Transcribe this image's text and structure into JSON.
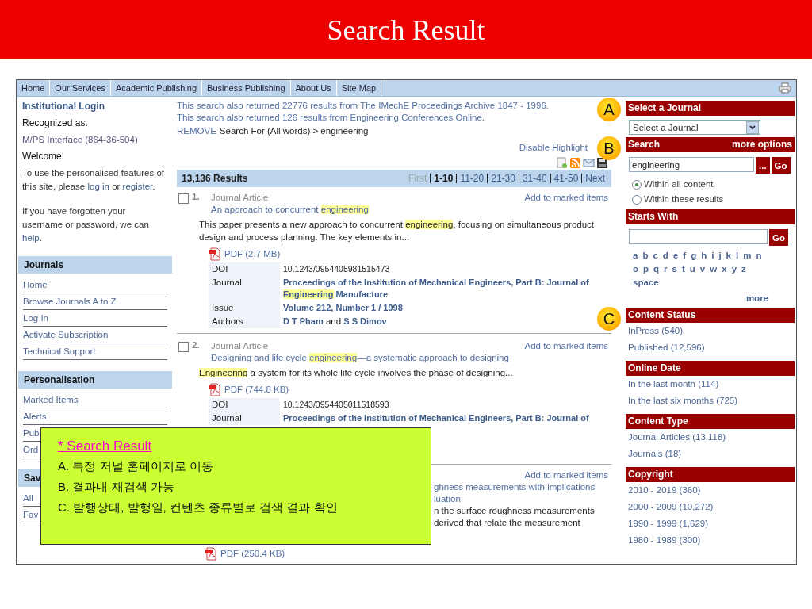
{
  "slide_title": "Search Result",
  "nav": {
    "items": [
      "Home",
      "Our Services",
      "Academic Publishing",
      "Business Publishing",
      "About Us",
      "Site Map"
    ]
  },
  "callouts": [
    "A",
    "B",
    "C"
  ],
  "left": {
    "login_title": "Institutional Login",
    "recognized_label": "Recognized as:",
    "recognized_value": "M/PS Interface (864-36-504)",
    "welcome": "Welcome!",
    "paragraphs": [
      [
        {
          "text": "To use the personalised features of this site, please ",
          "link": false
        },
        {
          "text": "log in",
          "link": true
        },
        {
          "text": " or ",
          "link": false
        },
        {
          "text": "register",
          "link": true
        },
        {
          "text": ".",
          "link": false
        }
      ],
      [
        {
          "text": "If you have forgotten your username or password, we can ",
          "link": false
        },
        {
          "text": "help",
          "link": true
        },
        {
          "text": ".",
          "link": false
        }
      ]
    ],
    "sections": [
      {
        "title": "Journals",
        "items": [
          "Home",
          "Browse Journals A to Z",
          "Log In",
          "Activate Subscription",
          "Technical Support"
        ]
      },
      {
        "title": "Personalisation",
        "items": [
          "Marked Items",
          "Alerts",
          "Pub",
          "Ord"
        ]
      },
      {
        "title": "Sav",
        "items": [
          "All",
          "Fav"
        ]
      }
    ]
  },
  "main": {
    "notices": [
      "This search also returned 22776 results from The IMechE Proceedings Archive 1847 - 1996.",
      "This search also returned 126 results from Engineering Conferences Online."
    ],
    "remove_link": "REMOVE",
    "search_for": "Search For (All words) > engineering",
    "disable_highlight": "Disable Highlight",
    "results_bar": {
      "count": "13,136 Results",
      "pages": [
        {
          "label": "First",
          "selected": false,
          "disabled": true
        },
        {
          "label": "1-10",
          "selected": true,
          "disabled": false
        },
        {
          "label": "11-20",
          "selected": false,
          "disabled": false
        },
        {
          "label": "21-30",
          "selected": false,
          "disabled": false
        },
        {
          "label": "31-40",
          "selected": false,
          "disabled": false
        },
        {
          "label": "41-50",
          "selected": false,
          "disabled": false
        },
        {
          "label": "Next",
          "selected": false,
          "disabled": false
        }
      ]
    },
    "results": [
      {
        "kind": "full",
        "number": "1.",
        "checked": false,
        "type": "Journal Article",
        "add": "Add to marked items",
        "title": [
          {
            "text": "An approach to concurrent ",
            "highlight": false
          },
          {
            "text": "engineering",
            "highlight": true
          }
        ],
        "snippet": [
          {
            "text": "This paper presents a new approach to concurrent ",
            "highlight": false
          },
          {
            "text": "engineering",
            "highlight": true
          },
          {
            "text": ", focusing on simultaneous product design and process planning. The key elements in...",
            "highlight": false
          }
        ],
        "pdf": "PDF (2.7 MB)",
        "meta": [
          {
            "label": "DOI",
            "kind": "plain",
            "value": [
              {
                "text": "10.1243/0954405981515473"
              }
            ]
          },
          {
            "label": "Journal",
            "kind": "link",
            "value": [
              {
                "text": "Proceedings of the Institution of Mechanical Engineers, Part B: Journal of ",
                "highlight": false
              },
              {
                "text": "Engineering",
                "highlight": true
              },
              {
                "text": " Manufacture",
                "highlight": false
              }
            ]
          },
          {
            "label": "Issue",
            "kind": "link",
            "value": [
              {
                "text": "Volume 212, Number 1 / 1998",
                "highlight": false
              }
            ]
          },
          {
            "label": "Authors",
            "kind": "authors",
            "value": [
              {
                "text": "D T Pham",
                "link": true
              },
              {
                "text": " and ",
                "link": false
              },
              {
                "text": "S S Dimov",
                "link": true
              }
            ]
          }
        ]
      },
      {
        "kind": "full",
        "number": "2.",
        "checked": false,
        "type": "Journal Article",
        "add": "Add to marked items",
        "title": [
          {
            "text": "Designing and life cycle ",
            "highlight": false
          },
          {
            "text": "engineering",
            "highlight": true
          },
          {
            "text": "—a systematic approach to designing",
            "highlight": false
          }
        ],
        "snippet": [
          {
            "text": "Engineering",
            "highlight": true
          },
          {
            "text": " a system for its whole life cycle involves the phase of designing...",
            "highlight": false
          }
        ],
        "pdf": "PDF (744.8 KB)",
        "meta": [
          {
            "label": "DOI",
            "kind": "plain",
            "value": [
              {
                "text": "10.1243/0954405011518593"
              }
            ]
          },
          {
            "label": "Journal",
            "kind": "link",
            "value": [
              {
                "text": "Proceedings of the Institution of Mechanical Engineers, Part B: Journal of",
                "highlight": false
              }
            ]
          }
        ]
      },
      {
        "kind": "partial",
        "add": "Add to marked items",
        "title_lines": [
          "ghness measurements with implications",
          "luation"
        ],
        "snippet_lines": [
          "n the surface roughness measurements",
          "derived that relate the measurement"
        ],
        "pdf": "PDF (250.4 KB)"
      }
    ]
  },
  "right": {
    "journal_header": "Select a Journal",
    "journal_select": "Select a Journal",
    "search_header": "Search",
    "more_options": "more options",
    "search_value": "engineering",
    "dots_button": "...",
    "go_button": "Go",
    "scope": [
      {
        "label": "Within all content",
        "selected": true
      },
      {
        "label": "Within these results",
        "selected": false
      }
    ],
    "starts_header": "Starts With",
    "starts_go": "Go",
    "letters": [
      "a",
      "b",
      "c",
      "d",
      "e",
      "f",
      "g",
      "h",
      "i",
      "j",
      "k",
      "l",
      "m",
      "n",
      "o",
      "p",
      "q",
      "r",
      "s",
      "t",
      "u",
      "v",
      "w",
      "x",
      "y",
      "z",
      "space"
    ],
    "more": "more",
    "facets": [
      {
        "title": "Content Status",
        "items": [
          "InPress (540)",
          "Published (12,596)"
        ]
      },
      {
        "title": "Online Date",
        "items": [
          "In the last month (114)",
          "In the last six months (725)"
        ]
      },
      {
        "title": "Content Type",
        "items": [
          "Journal Articles (13,118)",
          "Journals (18)"
        ]
      },
      {
        "title": "Copyright",
        "items": [
          "2010 - 2019 (360)",
          "2000 - 2009 (10,272)",
          "1990 - 1999 (1,629)",
          "1980 - 1989 (300)"
        ]
      }
    ]
  },
  "note": {
    "title": "* Search Result",
    "lines": [
      "A. 특정 저널 홈페이지로 이동",
      "B. 결과내 재검색 가능",
      "C. 발행상태, 발행일, 컨텐츠 종류별로 검색 결과 확인"
    ]
  }
}
